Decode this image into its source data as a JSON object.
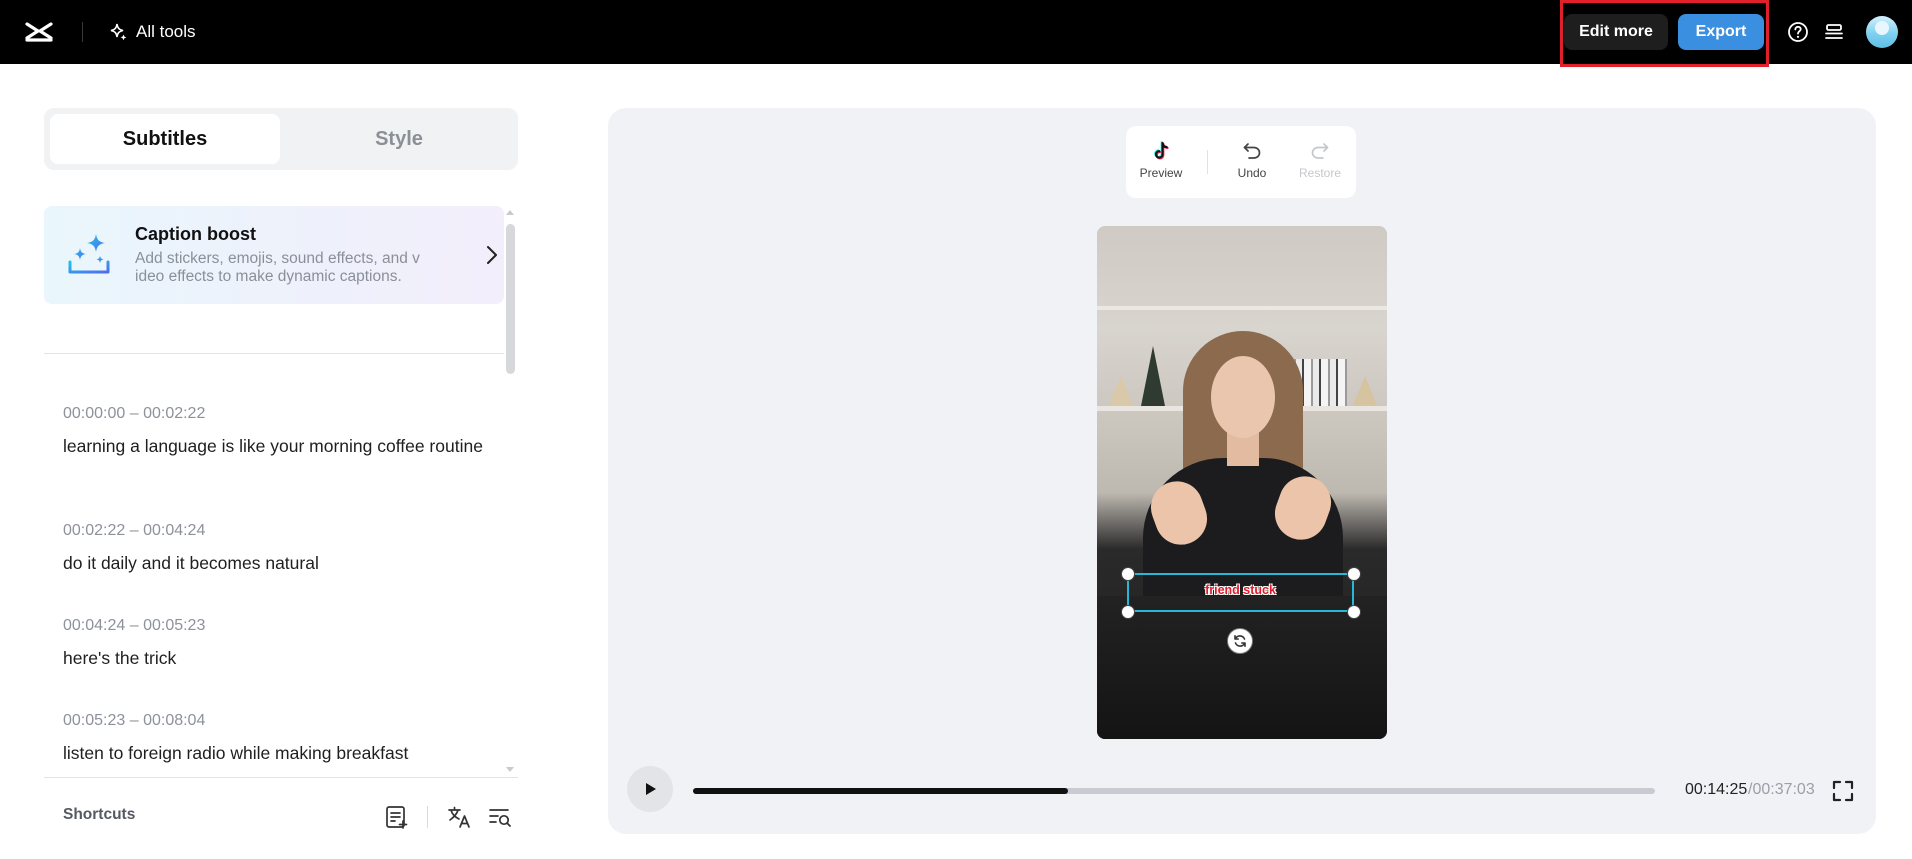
{
  "topbar": {
    "all_tools_label": "All tools",
    "edit_more_label": "Edit more",
    "export_label": "Export",
    "icons": [
      "capcut-logo-icon",
      "sparkle-icon",
      "help-icon",
      "layers-icon",
      "avatar"
    ]
  },
  "tabs": [
    {
      "label": "Subtitles",
      "active": true
    },
    {
      "label": "Style",
      "active": false
    }
  ],
  "caption_boost": {
    "title": "Caption boost",
    "description": "Add stickers, emojis, sound effects, and video effects to make dynamic captions."
  },
  "subtitles": [
    {
      "time": "00:00:00 – 00:02:22",
      "text": "learning a language is like your morning coffee routine"
    },
    {
      "time": "00:02:22 – 00:04:24",
      "text": "do it daily and it becomes natural"
    },
    {
      "time": "00:04:24 – 00:05:23",
      "text": "here's the trick"
    },
    {
      "time": "00:05:23 – 00:08:04",
      "text": "listen to foreign radio while making breakfast"
    }
  ],
  "shortcuts": {
    "label": "Shortcuts"
  },
  "preview_toolbar": {
    "preview_label": "Preview",
    "undo_label": "Undo",
    "restore_label": "Restore"
  },
  "video": {
    "caption_text": "friend stuck"
  },
  "playback": {
    "current_time": "00:14:25",
    "total_time": "/00:37:03",
    "progress_fraction": 0.39
  },
  "colors": {
    "accent": "#3b8fe0",
    "highlight_border": "#e0202a",
    "selection": "#26b8d6",
    "caption": "#e11b2a"
  }
}
